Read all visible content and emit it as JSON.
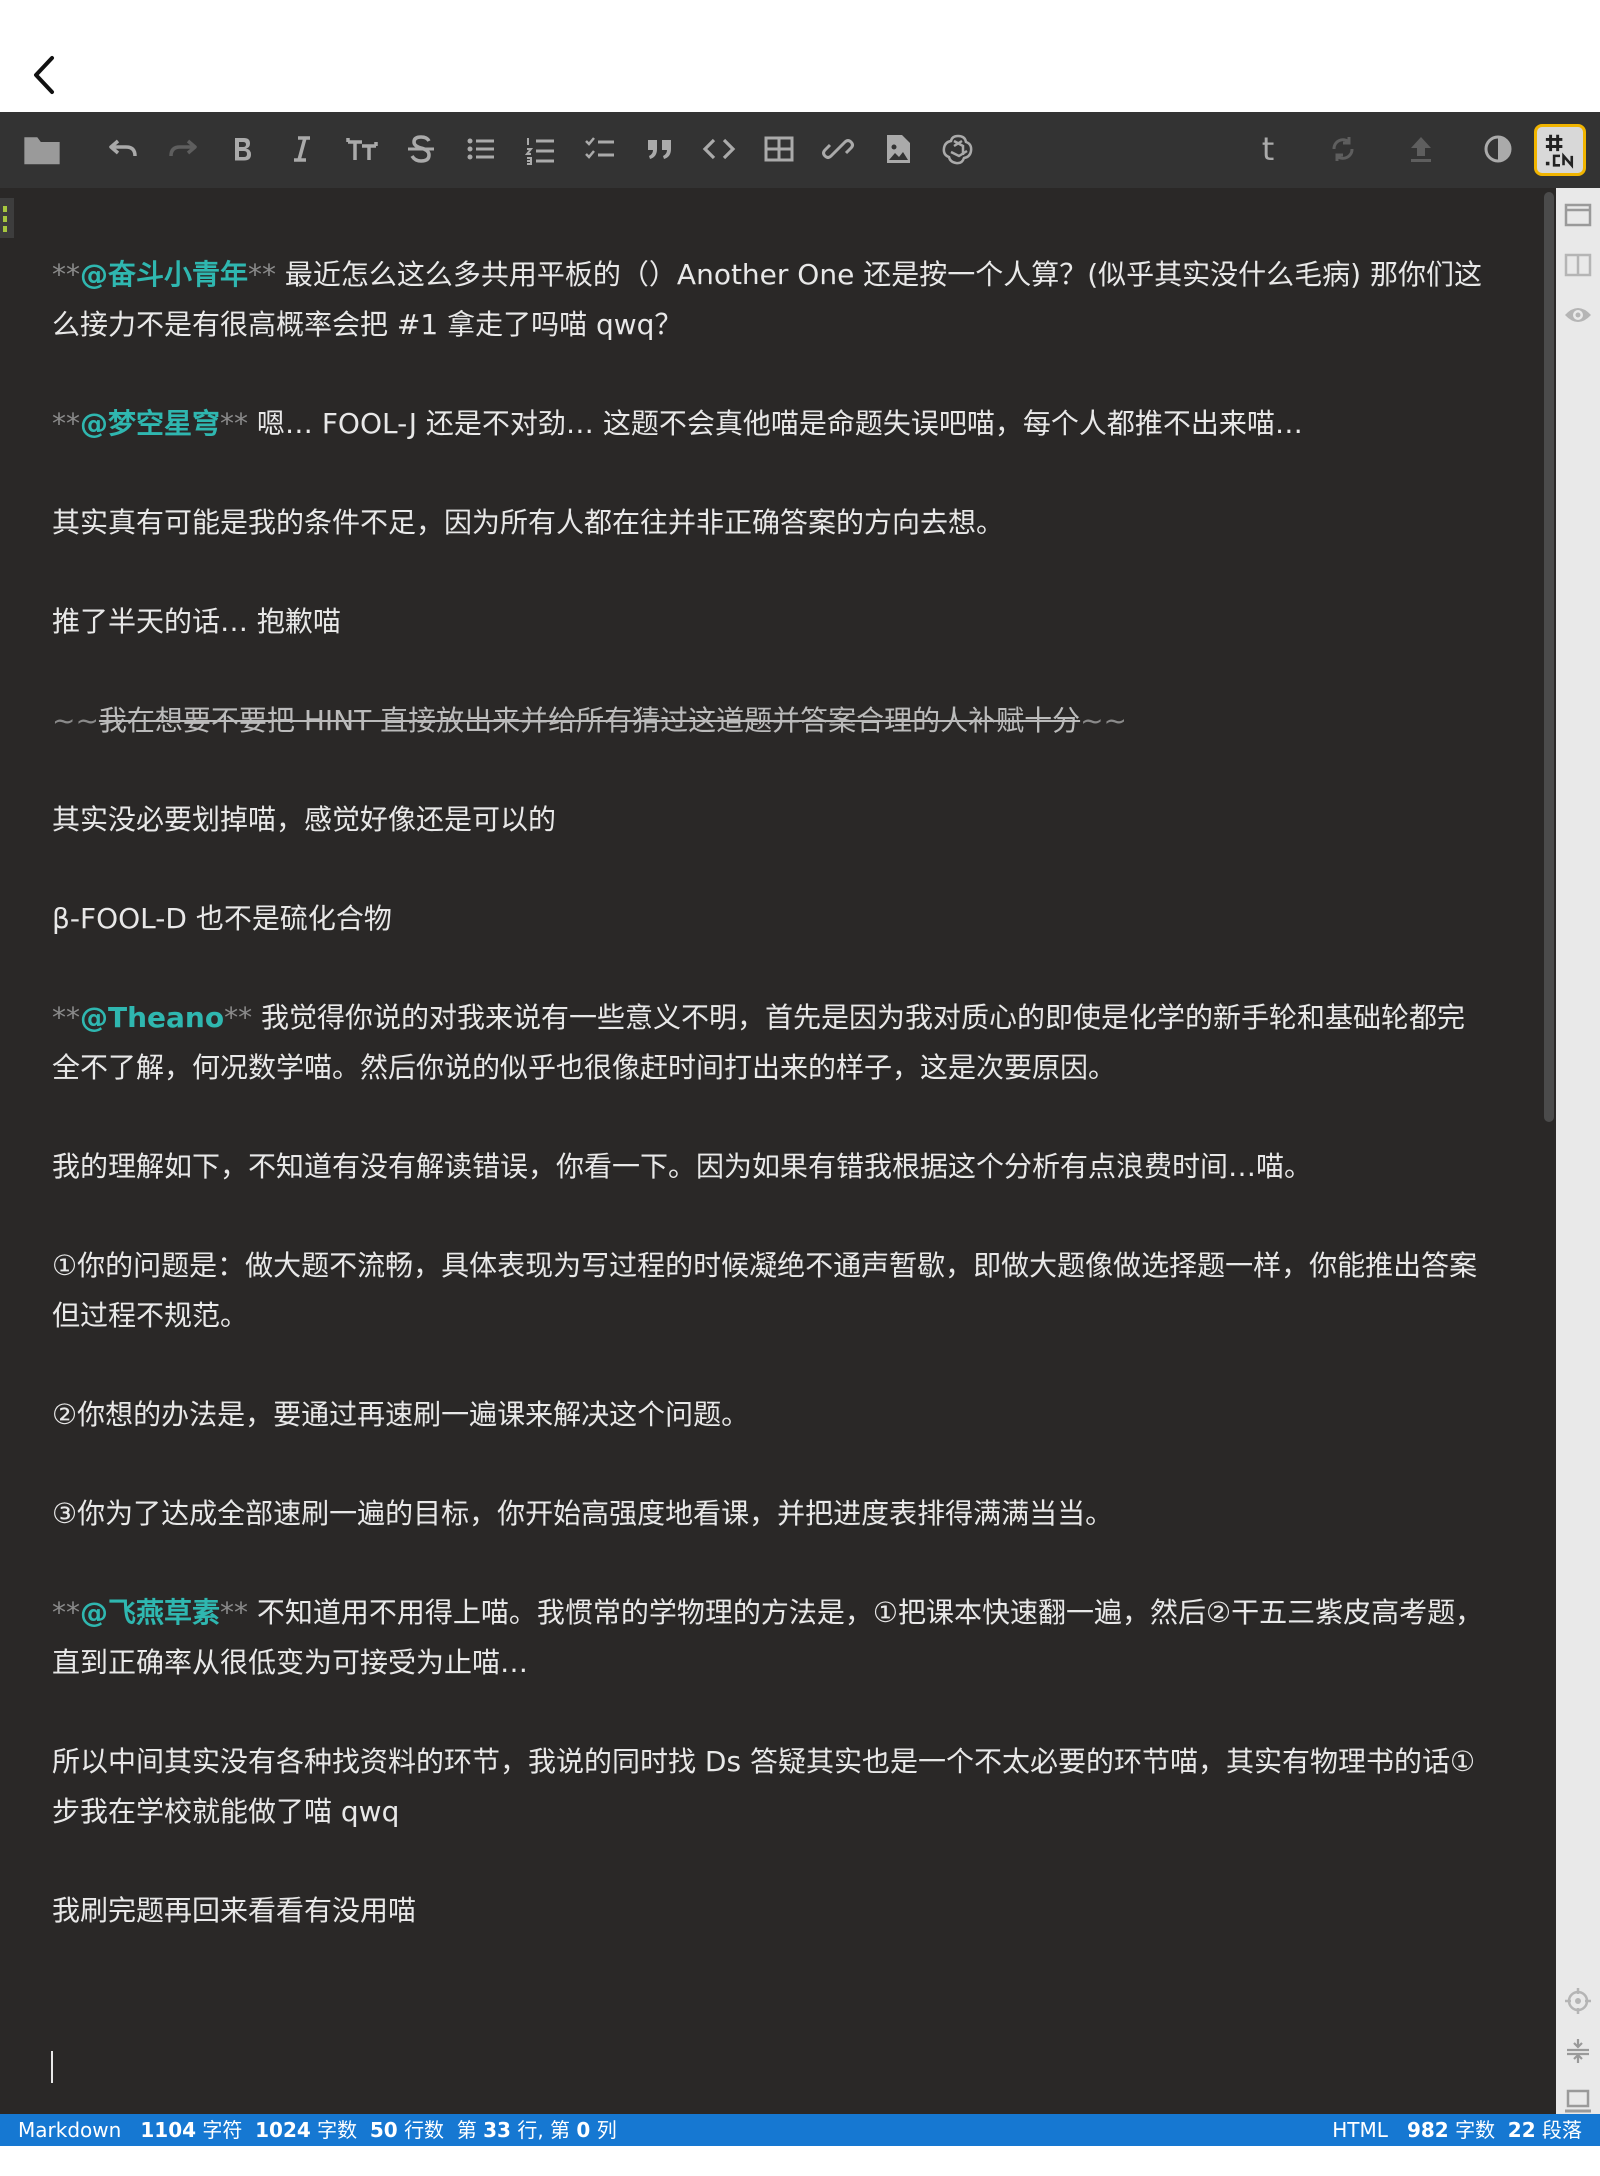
{
  "status_bar": {
    "mode": "Markdown",
    "chars": "1104",
    "chars_label": "字符",
    "words": "1024",
    "words_label": "字数",
    "lines": "50",
    "lines_label": "行数",
    "position_prefix": "第",
    "line_num": "33",
    "line_suffix": "行, 第",
    "col_num": "0",
    "col_suffix": "列",
    "preview_mode": "HTML",
    "preview_words": "982",
    "preview_words_label": "字数",
    "paragraphs": "22",
    "paragraphs_label": "段落"
  },
  "toolbar": {
    "t_label": "t"
  },
  "content": {
    "p1": {
      "mk_open": "**",
      "mention": "@奋斗小青年",
      "mk_close": "**",
      "text": " 最近怎么这么多共用平板的（）Another One 还是按一个人算？(似乎其实没什么毛病) 那你们这么接力不是有很高概率会把 #1 拿走了吗喵 qwq？"
    },
    "p2": {
      "mk_open": "**",
      "mention": "@梦空星穹",
      "mk_close": "**",
      "text": " 嗯… FOOL-J 还是不对劲… 这题不会真他喵是命题失误吧喵，每个人都推不出来喵…"
    },
    "p3": "其实真有可能是我的条件不足，因为所有人都在往并非正确答案的方向去想。",
    "p4": "推了半天的话… 抱歉喵",
    "p5": {
      "mk_open": "~~",
      "text": "我在想要不要把 HINT 直接放出来并给所有猜过这道题并答案合理的人补赋十分",
      "mk_close": "~~"
    },
    "p6": "其实没必要划掉喵，感觉好像还是可以的",
    "p7": "β-FOOL-D 也不是硫化合物",
    "p8": {
      "mk_open": "**",
      "mention": "@Theano",
      "mk_close": "**",
      "text": " 我觉得你说的对我来说有一些意义不明，首先是因为我对质心的即使是化学的新手轮和基础轮都完全不了解，何况数学喵。然后你说的似乎也很像赶时间打出来的样子，这是次要原因。"
    },
    "p9": "我的理解如下，不知道有没有解读错误，你看一下。因为如果有错我根据这个分析有点浪费时间…喵。",
    "p10": "①你的问题是：做大题不流畅，具体表现为写过程的时候凝绝不通声暂歇，即做大题像做选择题一样，你能推出答案但过程不规范。",
    "p11": "②你想的办法是，要通过再速刷一遍课来解决这个问题。",
    "p12": "③你为了达成全部速刷一遍的目标，你开始高强度地看课，并把进度表排得满满当当。",
    "p13": {
      "mk_open": "**",
      "mention": "@飞燕草素",
      "mk_close": "**",
      "text": " 不知道用不用得上喵。我惯常的学物理的方法是，①把课本快速翻一遍，然后②干五三紫皮高考题，直到正确率从很低变为可接受为止喵…"
    },
    "p14": "所以中间其实没有各种找资料的环节，我说的同时找 Ds 答疑其实也是一个不太必要的环节喵，其实有物理书的话①步我在学校就能做了喵 qwq",
    "p15": "我刷完题再回来看看有没用喵"
  },
  "colors": {
    "editor_bg": "#2a2827",
    "toolbar_bg": "#333333",
    "mention": "#2fb7b0",
    "status_bar": "#1678d2",
    "side_panel": "#e9e9e9"
  }
}
